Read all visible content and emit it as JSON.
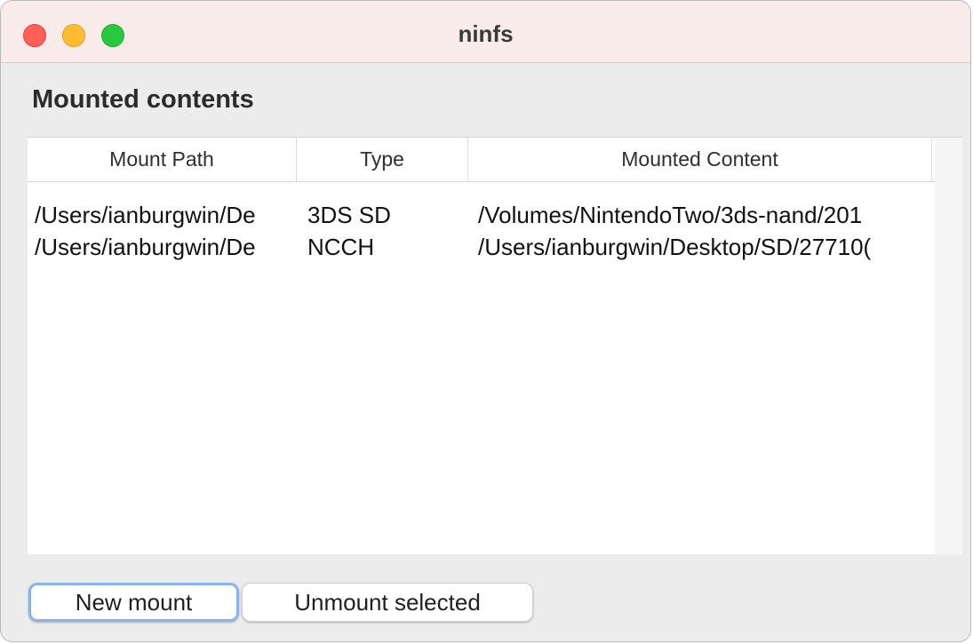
{
  "window": {
    "title": "ninfs"
  },
  "main": {
    "heading": "Mounted contents",
    "table": {
      "columns": [
        "Mount Path",
        "Type",
        "Mounted Content"
      ],
      "rows": [
        [
          "/Users/ianburgwin/De",
          "3DS SD",
          "/Volumes/NintendoTwo/3ds-nand/201"
        ],
        [
          "/Users/ianburgwin/De",
          "NCCH",
          "/Users/ianburgwin/Desktop/SD/27710("
        ]
      ]
    }
  },
  "buttons": {
    "new_mount": "New mount",
    "unmount_selected": "Unmount selected"
  },
  "colors": {
    "titlebar": "#f8ebea",
    "close": "#ff5f57",
    "minimize": "#febc2e",
    "maximize": "#28c840",
    "focus_ring": "#8ab3ec"
  }
}
